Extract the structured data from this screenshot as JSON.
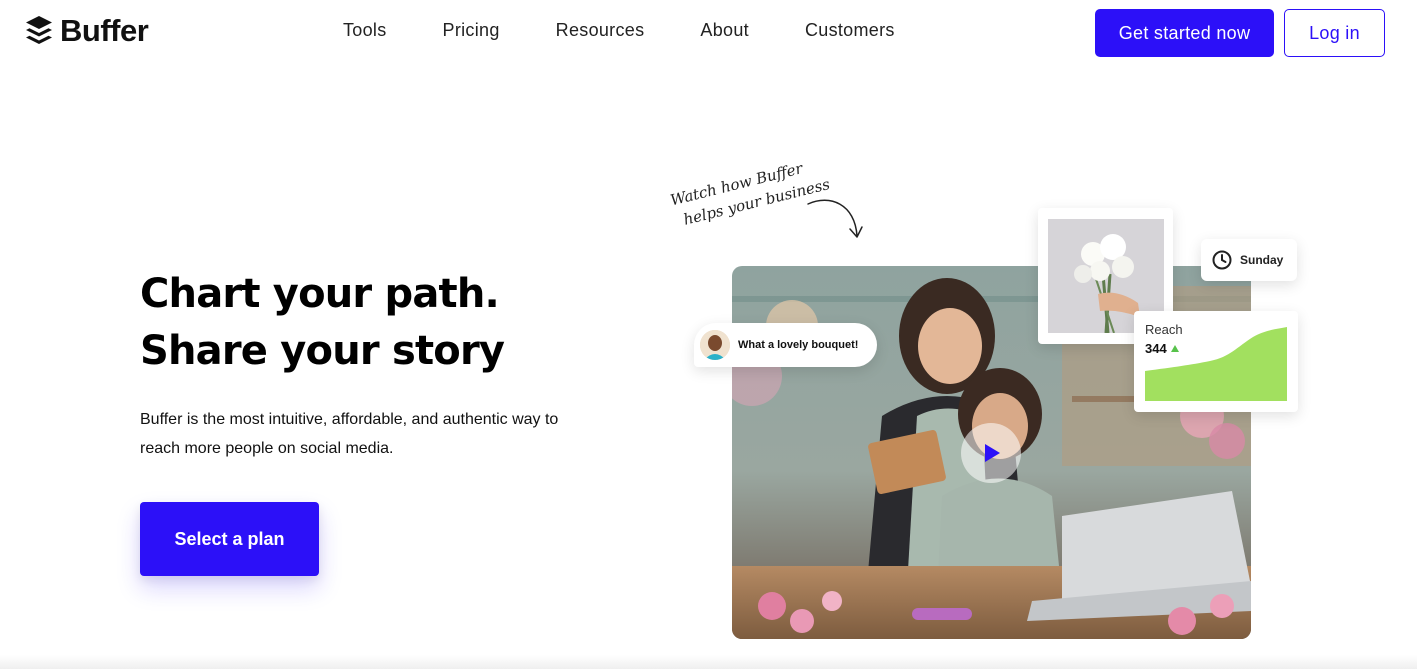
{
  "header": {
    "logo_text": "Buffer",
    "nav": [
      "Tools",
      "Pricing",
      "Resources",
      "About",
      "Customers"
    ],
    "cta_label": "Get started now",
    "login_label": "Log in"
  },
  "hero": {
    "title_line1": "Chart your path.",
    "title_line2": "Share your story",
    "description": "Buffer is the most intuitive, affordable, and authentic way to reach more people on social media.",
    "select_label": "Select a plan"
  },
  "video_section": {
    "note_line1": "Watch how Buffer",
    "note_line2": "helps your business",
    "comment_text": "What a lovely bouquet!",
    "schedule_day": "Sunday",
    "reach_label": "Reach",
    "reach_value": "344"
  },
  "colors": {
    "brand": "#2c10f8",
    "reach_chart": "#a2e05f"
  },
  "icons": [
    "buffer-logo-icon",
    "play-icon",
    "clock-icon",
    "trend-up-icon",
    "arrow-icon"
  ]
}
